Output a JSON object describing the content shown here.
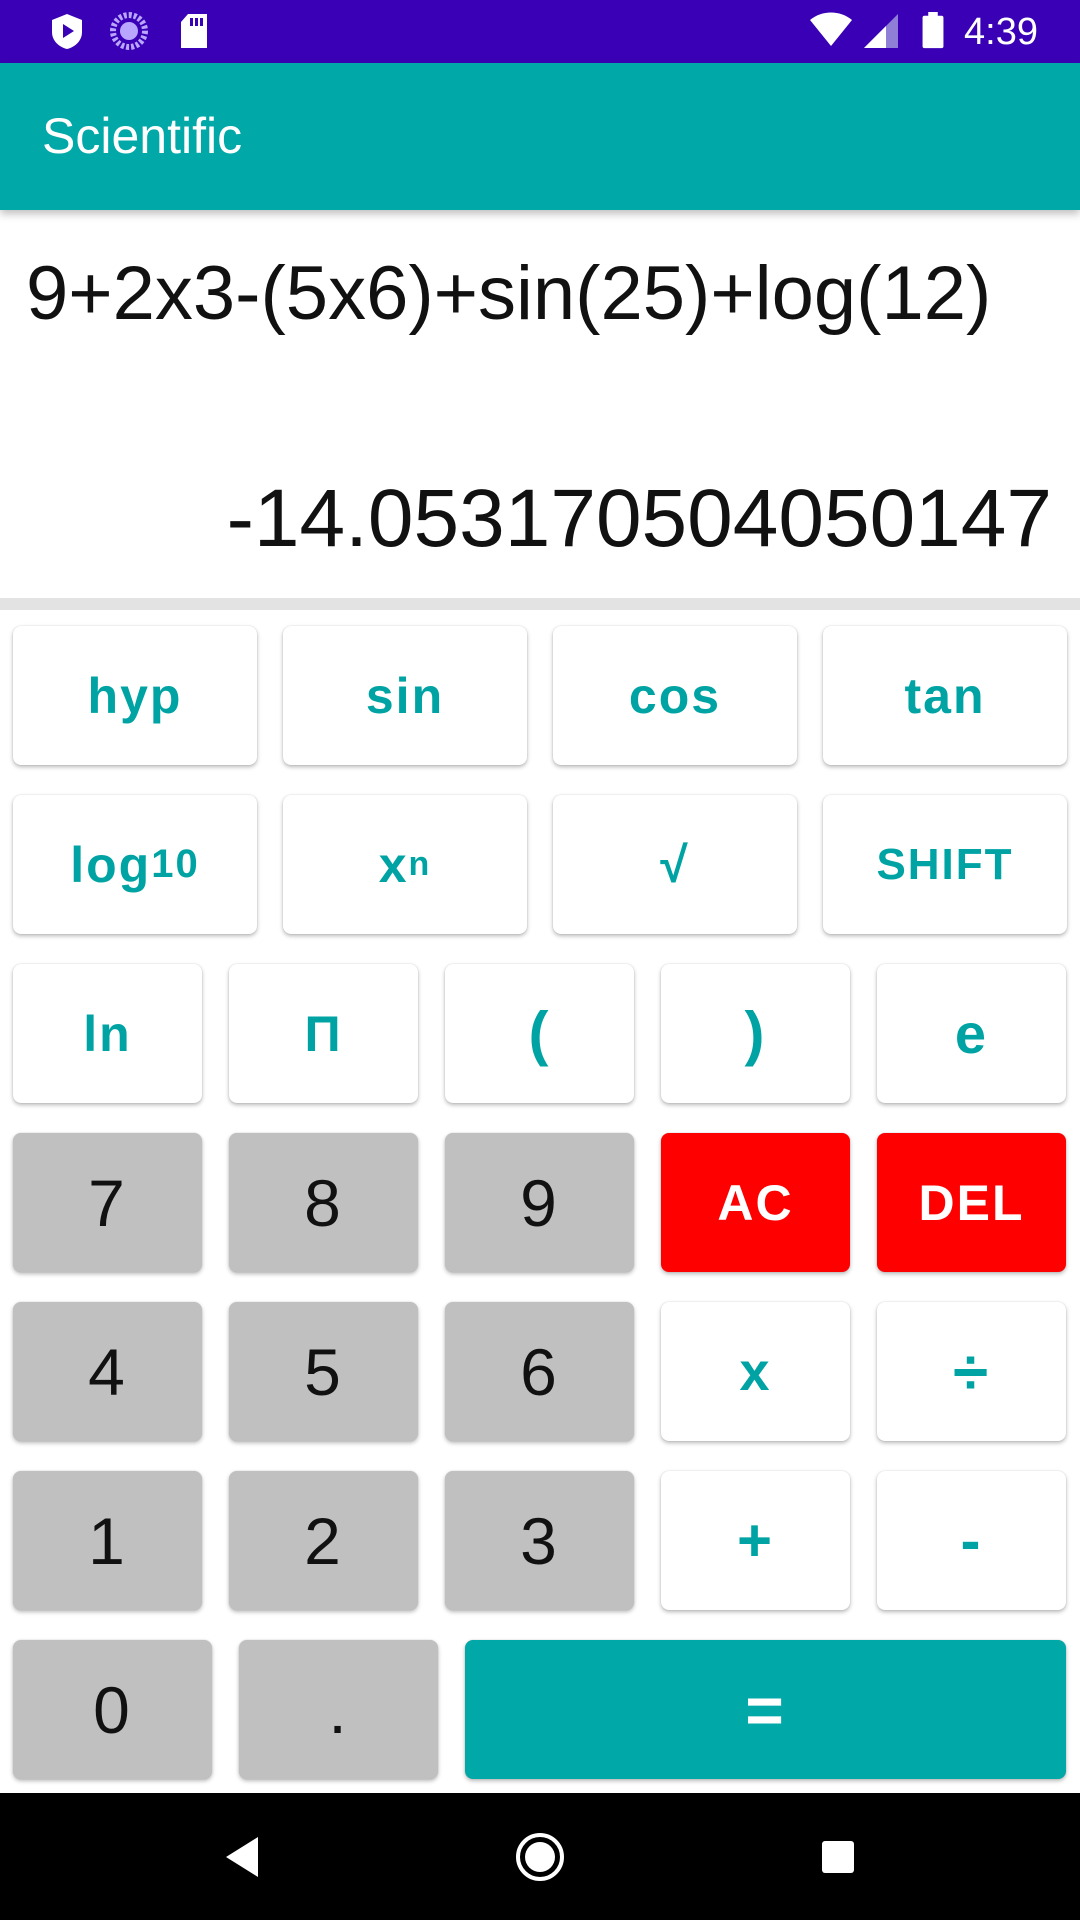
{
  "status_bar": {
    "time": "4:39",
    "icons": [
      "play-protect-icon",
      "loading-icon",
      "sd-card-icon",
      "wifi-icon",
      "signal-icon",
      "battery-icon"
    ]
  },
  "app_bar": {
    "title": "Scientific"
  },
  "display": {
    "expression": "9+2x3-(5x6)+sin(25)+log(12)",
    "result": "-14.053170504050147"
  },
  "keypad": {
    "row1": {
      "hyp": "hyp",
      "sin": "sin",
      "cos": "cos",
      "tan": "tan"
    },
    "row2": {
      "log_base": "log",
      "log_sub": "10",
      "pow_base": "x",
      "pow_sup": "n",
      "sqrt": "√",
      "shift": "SHIFT"
    },
    "row3": {
      "ln": "ln",
      "pi": "Π",
      "open_paren": "(",
      "close_paren": ")",
      "e": "e"
    },
    "row4": {
      "seven": "7",
      "eight": "8",
      "nine": "9",
      "ac": "AC",
      "del": "DEL"
    },
    "row5": {
      "four": "4",
      "five": "5",
      "six": "6",
      "multiply": "x",
      "divide": "÷"
    },
    "row6": {
      "one": "1",
      "two": "2",
      "three": "3",
      "plus": "+",
      "minus": "-"
    },
    "row7": {
      "zero": "0",
      "dot": ".",
      "equals": "="
    }
  },
  "colors": {
    "status_bar": "#3a00b5",
    "app_bar": "#00a8a8",
    "accent_text": "#00a3a3",
    "number_key": "#c0c0c0",
    "danger_key": "#ff0000"
  },
  "nav_bar": {
    "icons": [
      "back-icon",
      "home-icon",
      "recents-icon"
    ]
  }
}
